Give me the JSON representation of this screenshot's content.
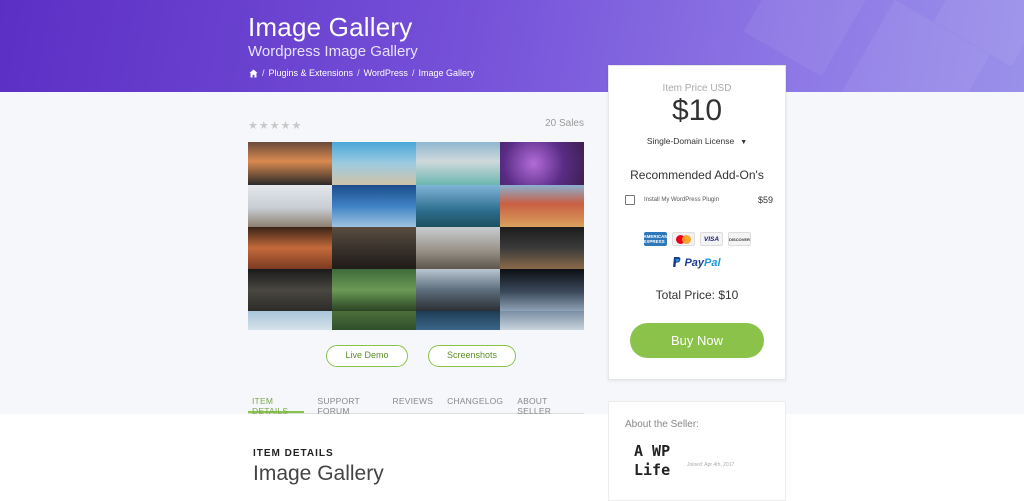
{
  "hero": {
    "title": "Image Gallery",
    "subtitle": "Wordpress Image Gallery",
    "breadcrumb": [
      "Plugins & Extensions",
      "WordPress",
      "Image Gallery"
    ],
    "separator": "/"
  },
  "product": {
    "stars": "★★★★★",
    "sales": "20 Sales",
    "buttons": {
      "live_demo": "Live Demo",
      "screenshots": "Screenshots"
    },
    "tabs": [
      "ITEM DETAILS",
      "SUPPORT FORUM",
      "REVIEWS",
      "CHANGELOG",
      "ABOUT SELLER"
    ],
    "section_label": "ITEM DETAILS",
    "section_title": "Image Gallery"
  },
  "purchase": {
    "price_label": "Item Price USD",
    "price": "$10",
    "license": "Single-Domain License",
    "addons_title": "Recommended Add-On's",
    "addon": {
      "name": "Install My WordPress Plugin",
      "price": "$59",
      "checked": false
    },
    "payment_cards": {
      "amex": "AMERICAN EXPRESS",
      "mastercard": "MasterCard",
      "visa": "VISA",
      "discover": "DISCOVER"
    },
    "paypal": {
      "pay": "Pay",
      "pal": "Pal"
    },
    "total": "Total Price: $10",
    "buy_label": "Buy Now"
  },
  "seller": {
    "label": "About the Seller:",
    "logo_line1": "A WP",
    "logo_line2": "Life",
    "joined": "Joined: Apr 4th, 2017"
  },
  "colors": {
    "accent_green": "#8bc34a",
    "hero_gradient_start": "#5b2fc4",
    "hero_gradient_end": "#9a91ea"
  },
  "icons": [
    "home-icon",
    "chevron-down-icon",
    "paypal-icon"
  ]
}
